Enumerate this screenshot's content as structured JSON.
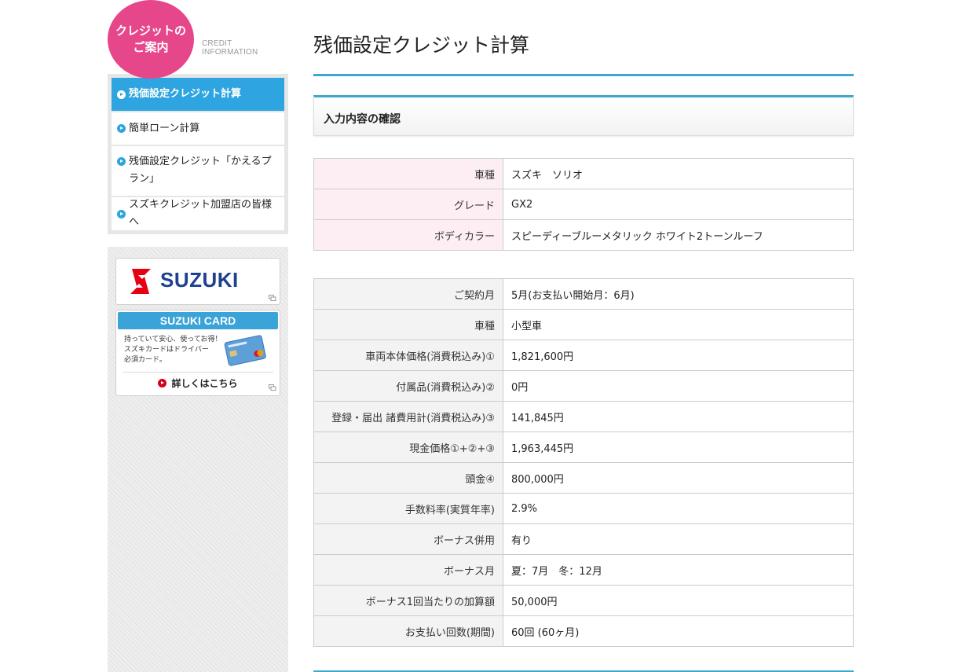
{
  "sidebar": {
    "badge": "クレジットの\nご案内",
    "credit_label": "CREDIT INFORMATION",
    "menu": [
      {
        "label": "残価設定クレジット計算",
        "active": true
      },
      {
        "label": "簡単ローン計算",
        "active": false
      },
      {
        "label": "残価設定クレジット「かえるプラン」",
        "active": false
      },
      {
        "label": "スズキクレジット加盟店の皆様へ",
        "active": false
      }
    ],
    "suzuki_banner": {
      "logo_text": "SUZUKI"
    },
    "card_banner": {
      "title": "SUZUKI CARD",
      "description": "持っていて安心、使ってお得！\nスズキカードはドライバー\n必須カード。",
      "link": "詳しくはこちら"
    }
  },
  "main": {
    "title": "残価設定クレジット計算",
    "section_heading": "入力内容の確認",
    "car_table": [
      {
        "label": "車種",
        "value": "スズキ　ソリオ"
      },
      {
        "label": "グレード",
        "value": "GX2"
      },
      {
        "label": "ボディカラー",
        "value": "スピーディーブルーメタリック ホワイト2トーンルーフ"
      }
    ],
    "plan_table": [
      {
        "label": "ご契約月",
        "value": "5月(お支払い開始月：6月)"
      },
      {
        "label": "車種",
        "value": "小型車"
      },
      {
        "label": "車両本体価格(消費税込み)①",
        "value": "1,821,600円"
      },
      {
        "label": "付属品(消費税込み)②",
        "value": "0円"
      },
      {
        "label": "登録・届出 諸費用計(消費税込み)③",
        "value": "141,845円"
      },
      {
        "label": "現金価格①+②+③",
        "value": "1,963,445円"
      },
      {
        "label": "頭金④",
        "value": "800,000円"
      },
      {
        "label": "手数料率(実質年率)",
        "value": "2.9%"
      },
      {
        "label": "ボーナス併用",
        "value": "有り"
      },
      {
        "label": "ボーナス月",
        "value": "夏：7月　冬：12月"
      },
      {
        "label": "ボーナス1回当たりの加算額",
        "value": "50,000円"
      },
      {
        "label": "お支払い回数(期間)",
        "value": "60回 (60ヶ月)"
      }
    ]
  },
  "colors": {
    "accent_blue": "#2ea5e0",
    "badge_pink": "#e6468a",
    "car_label_bg": "#fceef3",
    "plan_label_bg": "#f3f3f3"
  }
}
